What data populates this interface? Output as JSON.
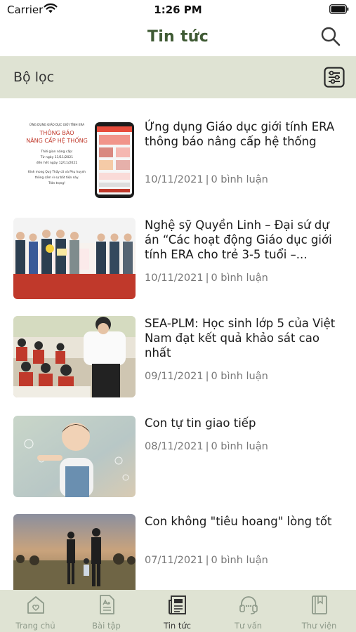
{
  "status_bar": {
    "carrier": "Carrier",
    "time": "1:26 PM"
  },
  "header": {
    "title": "Tin tức",
    "search_icon": "search-icon"
  },
  "filter": {
    "label": "Bộ lọc",
    "icon": "filter-sliders-icon"
  },
  "articles": [
    {
      "title": "Ứng dụng Giáo dục giới tính ERA thông báo nâng cấp hệ thống",
      "date": "10/11/2021",
      "comments": "0 bình luận",
      "thumb_text": {
        "org": "ỨNG DỤNG GIÁO DỤC GIỚI TÍNH ERA",
        "heading1": "THÔNG BÁO",
        "heading2": "NÂNG CẤP HỆ THỐNG",
        "line1": "Thời gian nâng cấp:",
        "line2": "Từ ngày 11/11/2021",
        "line3": "đến hết ngày 12/11/2021",
        "line4": "Kính mong Quý Thầy cô và Phụ huynh",
        "line5": "thông cảm vì sự bất tiện này.",
        "line6": "Trân trọng!"
      }
    },
    {
      "title": "Nghệ sỹ Quyền Linh – Đại sứ dự án “Các hoạt động Giáo dục giới tính ERA cho trẻ 3-5 tuổi –...",
      "date": "10/11/2021",
      "comments": "0 bình luận"
    },
    {
      "title": "SEA-PLM: Học sinh lớp 5 của Việt Nam đạt kết quả khảo sát cao nhất",
      "date": "09/11/2021",
      "comments": "0 bình luận"
    },
    {
      "title": "Con tự tin giao tiếp",
      "date": "08/11/2021",
      "comments": "0 bình luận"
    },
    {
      "title": "Con không \"tiêu hoang\" lòng tốt",
      "date": "07/11/2021",
      "comments": "0 bình luận"
    }
  ],
  "tabs": [
    {
      "label": "Trang chủ",
      "icon": "home-heart-icon",
      "active": false
    },
    {
      "label": "Bài tập",
      "icon": "exercise-document-icon",
      "active": false
    },
    {
      "label": "Tin tức",
      "icon": "newspaper-icon",
      "active": true
    },
    {
      "label": "Tư vấn",
      "icon": "headset-icon",
      "active": false
    },
    {
      "label": "Thư viện",
      "icon": "library-book-icon",
      "active": false
    }
  ],
  "colors": {
    "accent": "#3f5a34",
    "bar_background": "#dfe3d3",
    "inactive_tab": "#8e9a8a",
    "meta_text": "#777777"
  }
}
